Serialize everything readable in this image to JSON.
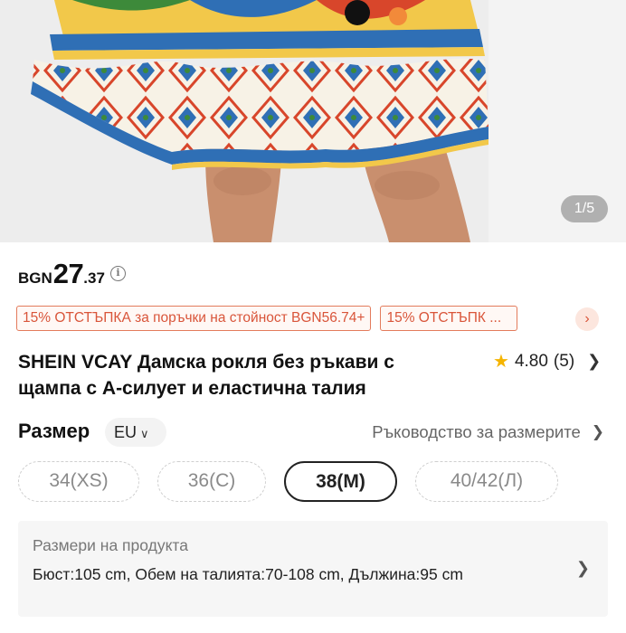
{
  "gallery": {
    "counter": "1/5",
    "colors": {
      "skirt_blue": "#2f6fb5",
      "skirt_red": "#d8462b",
      "skirt_green": "#3d8a3a",
      "skirt_yellow": "#f2c84a",
      "skin": "#c98f6e"
    }
  },
  "price": {
    "currency": "BGN",
    "integer": "27",
    "decimal": ".37",
    "info_icon": "info-icon"
  },
  "coupons": {
    "items": [
      "15% ОТСТЪПКА за поръчки на стойност BGN56.74+",
      "15% ОТСТЪПК ..."
    ],
    "more_icon": "chevron-right-icon"
  },
  "product": {
    "title": "SHEIN VCAY Дамска рокля без ръкави с щампа с А-силует и еластична талия",
    "rating": "4.80",
    "review_count": "(5)"
  },
  "size_section": {
    "label": "Размер",
    "region": "EU",
    "guide": "Ръководство за размерите",
    "options": [
      "34(XS)",
      "36(С)",
      "38(М)",
      "40/42(Л)"
    ],
    "selected": "38(М)"
  },
  "measurements": {
    "heading": "Размери на продукта",
    "details": "Бюст:105 cm, Обем на талията:70-108 cm, Дължина:95 cm"
  },
  "colors": {
    "accent": "#e37b5c",
    "accent_text": "#d9553a",
    "star": "#f5b400"
  }
}
